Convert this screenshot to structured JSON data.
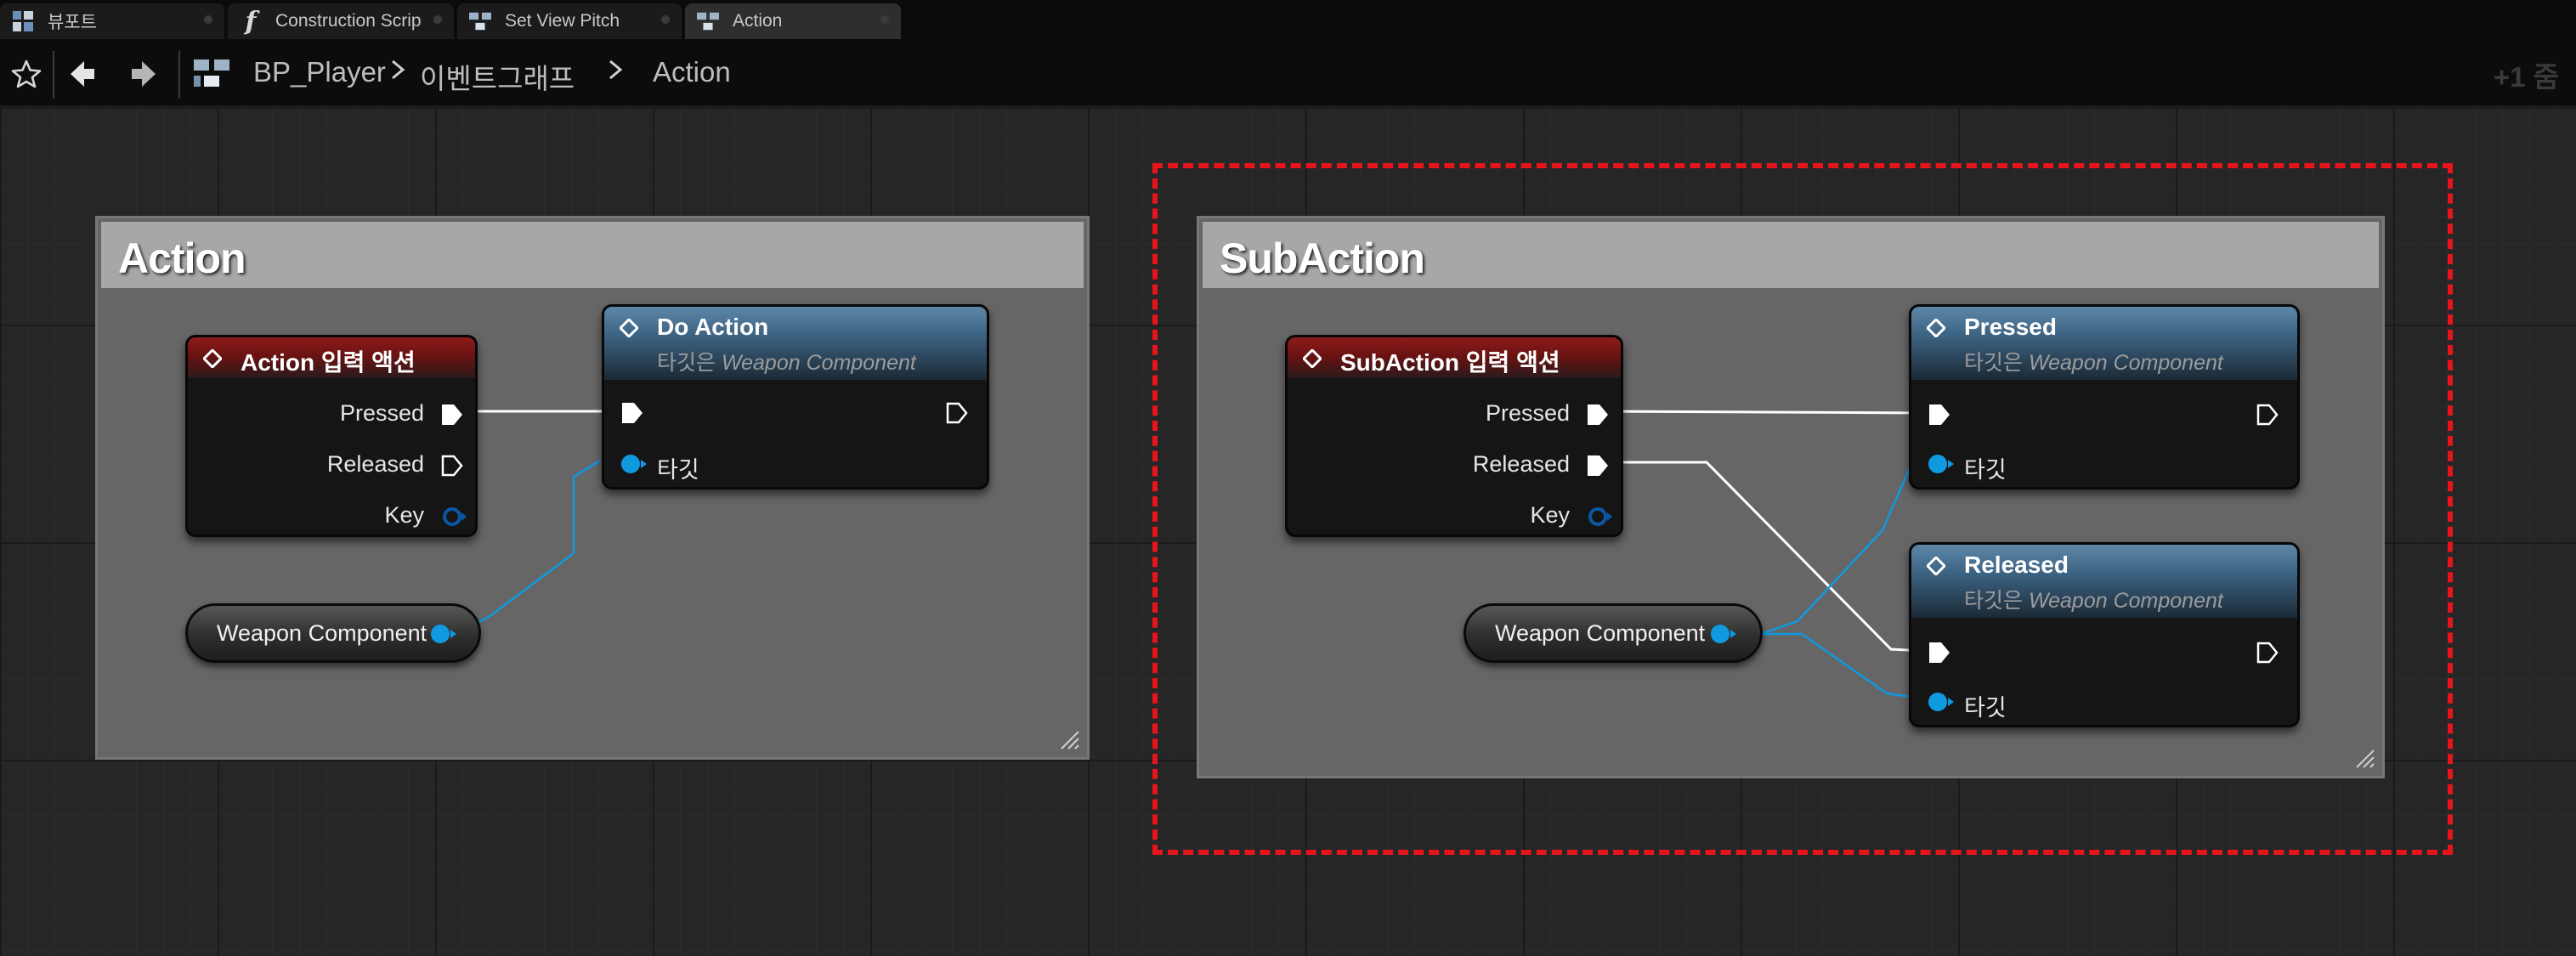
{
  "tabs": [
    {
      "label": "뷰포트",
      "icon": "viewport-icon",
      "active": false
    },
    {
      "label": "Construction Scrip",
      "icon": "function-icon",
      "active": false
    },
    {
      "label": "Set View Pitch",
      "icon": "graph-icon",
      "active": false
    },
    {
      "label": "Action",
      "icon": "graph-icon",
      "active": true
    }
  ],
  "toolbar": {
    "breadcrumb": [
      "BP_Player",
      "이벤트그래프",
      "Action"
    ],
    "zoom": "+1 줌"
  },
  "graph": {
    "comment_action": "Action",
    "comment_subaction": "SubAction",
    "action_event": {
      "title": "Action 입력 액션",
      "pins": [
        "Pressed",
        "Released",
        "Key"
      ]
    },
    "do_action": {
      "title": "Do Action",
      "subtitle_prefix": "타깃은",
      "subtitle_target": "Weapon Component",
      "target_pin": "타깃"
    },
    "weapon_var_1": "Weapon Component",
    "subaction_event": {
      "title": "SubAction 입력 액션",
      "pins": [
        "Pressed",
        "Released",
        "Key"
      ]
    },
    "pressed_call": {
      "title": "Pressed",
      "subtitle_prefix": "타깃은",
      "subtitle_target": "Weapon Component",
      "target_pin": "타깃"
    },
    "released_call": {
      "title": "Released",
      "subtitle_prefix": "타깃은",
      "subtitle_target": "Weapon Component",
      "target_pin": "타깃"
    },
    "weapon_var_2": "Weapon Component"
  },
  "colors": {
    "exec_wire": "#ffffff",
    "object_wire": "#0f9ae0",
    "selection": "#e8141c",
    "event_header": "#8f1b1b",
    "function_header": "#4f7799"
  }
}
